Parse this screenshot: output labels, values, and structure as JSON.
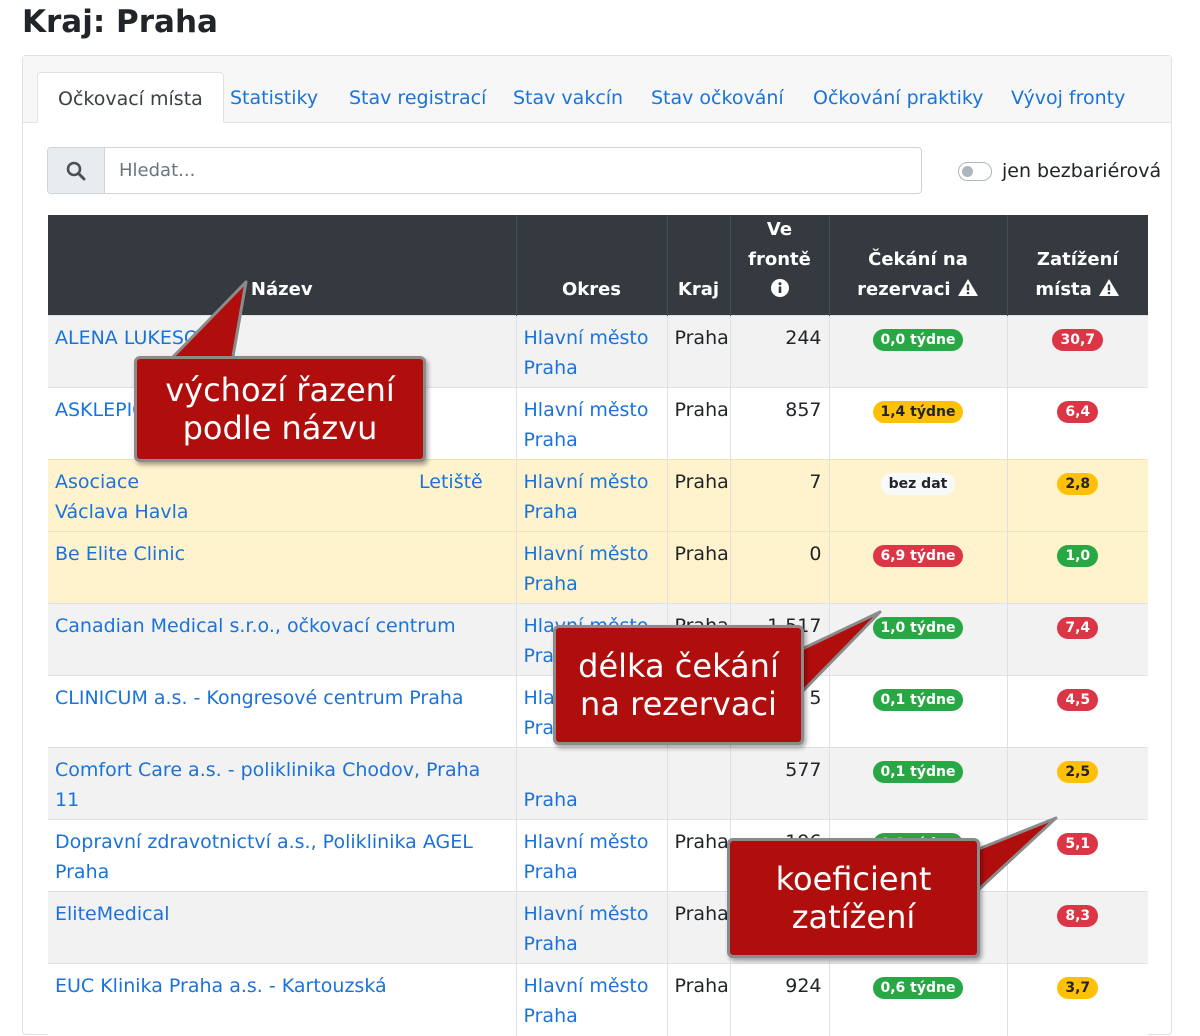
{
  "page_title": "Kraj: Praha",
  "tabs": [
    {
      "label": "Očkovací místa",
      "active": true
    },
    {
      "label": "Statistiky"
    },
    {
      "label": "Stav registrací"
    },
    {
      "label": "Stav vakcín"
    },
    {
      "label": "Stav očkování"
    },
    {
      "label": "Očkování praktiky"
    },
    {
      "label": "Vývoj fronty"
    }
  ],
  "search": {
    "placeholder": "Hledat..."
  },
  "filter": {
    "label": "jen bezbariérová",
    "checked": false
  },
  "table": {
    "headers": {
      "name": "Název",
      "okres": "Okres",
      "kraj": "Kraj",
      "queue": "Ve frontě",
      "wait_line1": "Čekání na",
      "wait_line2": "rezervaci",
      "load_line1": "Zatížení",
      "load_line2": "místa"
    },
    "rows": [
      {
        "name": "ALENA LUKESOVA",
        "okres_1": "Hlavní město",
        "okres_2": "Praha",
        "kraj": "Praha",
        "queue": "244",
        "wait": "0,0 týdne",
        "wait_status": "success",
        "load": "30,7",
        "load_status": "danger",
        "highlight": false
      },
      {
        "name": "ASKLEPIO",
        "okres_1": "Hlavní město",
        "okres_2": "Praha",
        "kraj": "Praha",
        "queue": "857",
        "wait": "1,4 týdne",
        "wait_status": "warning",
        "load": "6,4",
        "load_status": "danger",
        "highlight": false
      },
      {
        "name": "Asociace",
        "name_tail": "Letiště",
        "name_2": "Václava Havla",
        "okres_1": "Hlavní město",
        "okres_2": "Praha",
        "kraj": "Praha",
        "queue": "7",
        "wait": "bez dat",
        "wait_status": "light",
        "load": "2,8",
        "load_status": "warning",
        "highlight": true
      },
      {
        "name": "Be Elite Clinic",
        "okres_1": "Hlavní město",
        "okres_2": "Praha",
        "kraj": "Praha",
        "queue": "0",
        "wait": "6,9 týdne",
        "wait_status": "danger",
        "load": "1,0",
        "load_status": "success",
        "highlight": true
      },
      {
        "name": "Canadian Medical s.r.o., očkovací centrum",
        "okres_1": "Hlavní město",
        "okres_2": "Pra",
        "kraj": "Praha",
        "queue": "1 517",
        "wait": "1,0 týdne",
        "wait_status": "success",
        "load": "7,4",
        "load_status": "danger",
        "highlight": false
      },
      {
        "name": "CLINICUM a.s. - Kongresové centrum Praha",
        "okres_1": "Hla",
        "okres_2": "Pra",
        "kraj": "",
        "queue": "5",
        "wait": "0,1 týdne",
        "wait_status": "success",
        "load": "4,5",
        "load_status": "danger",
        "highlight": false
      },
      {
        "name": "Comfort Care a.s. - poliklinika Chodov, Praha 11",
        "okres_1": "",
        "okres_2": "Praha",
        "kraj": "",
        "queue": "577",
        "wait": "0,1 týdne",
        "wait_status": "success",
        "load": "2,5",
        "load_status": "warning",
        "highlight": false
      },
      {
        "name": "Dopravní zdravotnictví a.s., Poliklinika AGEL Praha",
        "okres_1": "Hlavní město",
        "okres_2": "Praha",
        "kraj": "Praha",
        "queue": "196",
        "wait": "0,9 týdne",
        "wait_status": "success",
        "load": "5,1",
        "load_status": "danger",
        "highlight": false
      },
      {
        "name": "EliteMedical",
        "okres_1": "Hlavní město",
        "okres_2": "Praha",
        "kraj": "Praha",
        "queue": "",
        "wait": "",
        "wait_status": "success",
        "load": "8,3",
        "load_status": "danger",
        "highlight": false
      },
      {
        "name": "EUC Klinika Praha a.s. - Kartouzská",
        "okres_1": "Hlavní město",
        "okres_2": "Praha",
        "kraj": "Praha",
        "queue": "924",
        "wait": "0,6 týdne",
        "wait_status": "success",
        "load": "3,7",
        "load_status": "warning",
        "highlight": false
      }
    ]
  },
  "annotations": {
    "sort_line1": "výchozí řazení",
    "sort_line2": "podle názvu",
    "wait_line1": "délka čekání",
    "wait_line2": "na rezervaci",
    "load_line1": "koeficient",
    "load_line2": "zatížení"
  },
  "colors": {
    "link": "#1a73d9",
    "header_bg": "#343a40",
    "highlight_row": "#fff3cd",
    "callout_bg": "#b00d0d",
    "badge_success": "#28a745",
    "badge_warning": "#ffc107",
    "badge_danger": "#dc3545"
  }
}
